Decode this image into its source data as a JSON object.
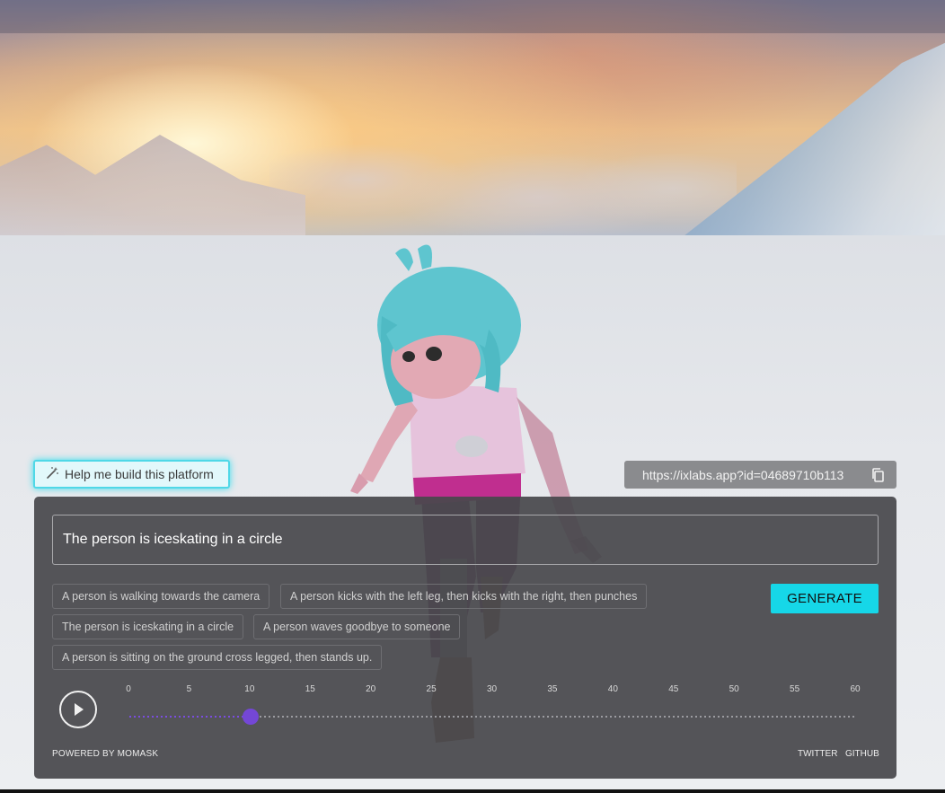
{
  "help_button": {
    "label": "Help me build this platform",
    "icon": "magic-wand-icon"
  },
  "share": {
    "url": "https://ixlabs.app?id=04689710b113",
    "icon": "copy-icon"
  },
  "prompt": {
    "value": "The person is iceskating in a circle"
  },
  "suggestions": [
    "A person is walking towards the camera",
    "A person kicks with the left leg, then kicks with the right, then punches",
    "The person is iceskating in a circle",
    "A person waves goodbye to someone",
    "A person is sitting on the ground cross legged, then stands up."
  ],
  "generate_label": "GENERATE",
  "timeline": {
    "ticks": [
      "0",
      "5",
      "10",
      "15",
      "20",
      "25",
      "30",
      "35",
      "40",
      "45",
      "50",
      "55",
      "60"
    ],
    "current": 10,
    "max": 60
  },
  "footer": {
    "powered_by": "POWERED BY MOMASK",
    "links": [
      "TWITTER",
      "GITHUB"
    ]
  },
  "colors": {
    "accent": "#16d7e8",
    "slider": "#7447d6",
    "panel": "#48484c"
  }
}
